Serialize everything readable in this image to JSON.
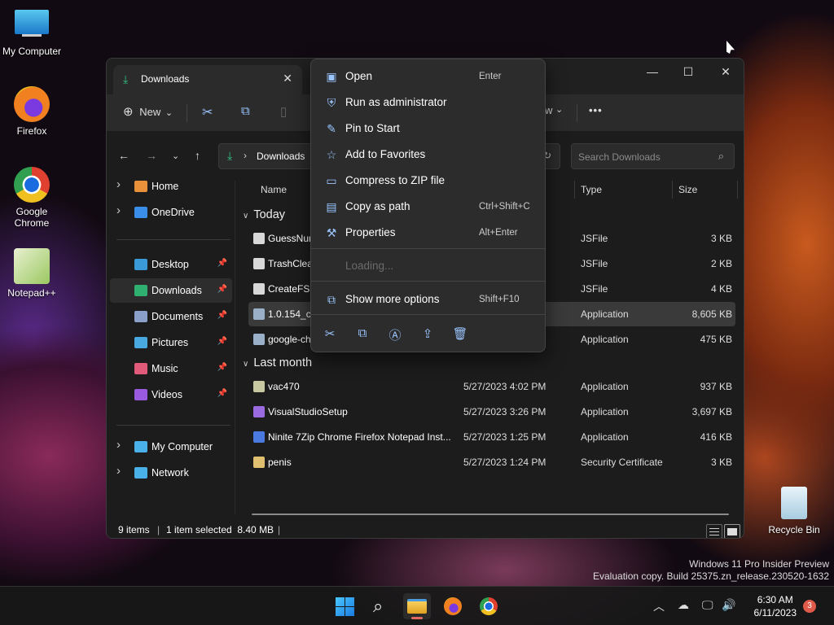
{
  "desktop": {
    "icons": [
      {
        "label": "My Computer",
        "icon": "monitor-icon"
      },
      {
        "label": "Firefox",
        "icon": "firefox-icon"
      },
      {
        "label": "Google Chrome",
        "icon": "chrome-icon"
      },
      {
        "label": "Notepad++",
        "icon": "notepadpp-icon"
      },
      {
        "label": "Recycle Bin",
        "icon": "recycle-bin-icon"
      }
    ],
    "watermark": {
      "line1": "Windows 11 Pro Insider Preview",
      "line2": "Evaluation copy. Build 25375.zn_release.230520-1632"
    }
  },
  "explorer": {
    "tab_title": "Downloads",
    "tab_close": "✕",
    "window_controls": {
      "minimize": "—",
      "maximize": "☐",
      "close": "✕"
    },
    "command_bar": {
      "new_label": "New",
      "new_arrow": "⌄",
      "view_partial": "w",
      "view_arrow": "⌄",
      "more": "•••"
    },
    "address": {
      "separator": "›",
      "location": "Downloads"
    },
    "search": {
      "placeholder": "Search Downloads"
    },
    "columns": {
      "name": "Name",
      "type": "Type",
      "size": "Size"
    },
    "sidebar": {
      "items": [
        {
          "label": "Home",
          "has_chevron": true,
          "pinned": false,
          "selected": false,
          "color": "#e8903a"
        },
        {
          "label": "OneDrive",
          "has_chevron": true,
          "pinned": false,
          "selected": false,
          "color": "#3a8ee8"
        },
        {
          "label": "Desktop",
          "has_chevron": false,
          "pinned": true,
          "selected": false,
          "color": "#3a9ad8"
        },
        {
          "label": "Downloads",
          "has_chevron": false,
          "pinned": true,
          "selected": true,
          "color": "#30b070"
        },
        {
          "label": "Documents",
          "has_chevron": false,
          "pinned": true,
          "selected": false,
          "color": "#8aa0c8"
        },
        {
          "label": "Pictures",
          "has_chevron": false,
          "pinned": true,
          "selected": false,
          "color": "#4aa8e0"
        },
        {
          "label": "Music",
          "has_chevron": false,
          "pinned": true,
          "selected": false,
          "color": "#e05a7a"
        },
        {
          "label": "Videos",
          "has_chevron": false,
          "pinned": true,
          "selected": false,
          "color": "#9a5ae0"
        },
        {
          "label": "My Computer",
          "has_chevron": true,
          "pinned": false,
          "selected": false,
          "color": "#4ab0e8"
        },
        {
          "label": "Network",
          "has_chevron": true,
          "pinned": false,
          "selected": false,
          "color": "#4ab0e8"
        }
      ]
    },
    "groups": {
      "today": "Today",
      "last_month": "Last month"
    },
    "files_today": [
      {
        "name": "GuessNur",
        "date": "",
        "type": "JSFile",
        "size": "3 KB",
        "selected": false,
        "color": "#d8d8d8"
      },
      {
        "name": "TrashClear",
        "date": "",
        "type": "JSFile",
        "size": "2 KB",
        "selected": false,
        "color": "#d8d8d8"
      },
      {
        "name": "CreateFS.j",
        "date": "",
        "type": "JSFile",
        "size": "4 KB",
        "selected": false,
        "color": "#d8d8d8"
      },
      {
        "name": "1.0.154_ch",
        "date": "",
        "type": "Application",
        "size": "8,605 KB",
        "selected": true,
        "color": "#9ab0c8"
      },
      {
        "name": "google-ch",
        "date": "",
        "type": "Application",
        "size": "475 KB",
        "selected": false,
        "color": "#9ab0c8"
      }
    ],
    "files_last_month": [
      {
        "name": "vac470",
        "date": "5/27/2023 4:02 PM",
        "type": "Application",
        "size": "937 KB",
        "selected": false,
        "color": "#c8c8a0"
      },
      {
        "name": "VisualStudioSetup",
        "date": "5/27/2023 3:26 PM",
        "type": "Application",
        "size": "3,697 KB",
        "selected": false,
        "color": "#9a6ae0"
      },
      {
        "name": "Ninite 7Zip Chrome Firefox Notepad Inst...",
        "date": "5/27/2023 1:25 PM",
        "type": "Application",
        "size": "416 KB",
        "selected": false,
        "color": "#4a7ae0"
      },
      {
        "name": "penis",
        "date": "5/27/2023 1:24 PM",
        "type": "Security Certificate",
        "size": "3 KB",
        "selected": false,
        "color": "#e0c070"
      }
    ],
    "status": {
      "items": "9 items",
      "divider": "|",
      "selected": "1 item selected  8.40 MB",
      "divider2": "|"
    }
  },
  "context_menu": {
    "items": [
      {
        "label": "Open",
        "shortcut": "Enter",
        "icon": "open-icon",
        "glyph": "▣",
        "disabled": false
      },
      {
        "label": "Run as administrator",
        "shortcut": "",
        "icon": "shield-icon",
        "glyph": "⛨",
        "disabled": false
      },
      {
        "label": "Pin to Start",
        "shortcut": "",
        "icon": "pin-icon",
        "glyph": "✎",
        "disabled": false
      },
      {
        "label": "Add to Favorites",
        "shortcut": "",
        "icon": "star-icon",
        "glyph": "☆",
        "disabled": false
      },
      {
        "label": "Compress to ZIP file",
        "shortcut": "",
        "icon": "zip-icon",
        "glyph": "▭",
        "disabled": false
      },
      {
        "label": "Copy as path",
        "shortcut": "Ctrl+Shift+C",
        "icon": "copy-path-icon",
        "glyph": "▤",
        "disabled": false
      },
      {
        "label": "Properties",
        "shortcut": "Alt+Enter",
        "icon": "wrench-icon",
        "glyph": "⚒",
        "disabled": false
      },
      {
        "label": "Loading...",
        "shortcut": "",
        "icon": "",
        "glyph": "",
        "disabled": true
      },
      {
        "label": "Show more options",
        "shortcut": "Shift+F10",
        "icon": "more-options-icon",
        "glyph": "⧉",
        "disabled": false
      }
    ],
    "actions": [
      {
        "icon": "cut-icon",
        "glyph": "✂"
      },
      {
        "icon": "copy-icon",
        "glyph": "⧉"
      },
      {
        "icon": "rename-icon",
        "glyph": "Ⓐ"
      },
      {
        "icon": "share-icon",
        "glyph": "⇪"
      },
      {
        "icon": "delete-icon",
        "glyph": "🗑"
      }
    ]
  },
  "taskbar": {
    "clock_time": "6:30 AM",
    "clock_date": "6/11/2023",
    "notification_count": "3",
    "tray": {
      "chevron": "︿",
      "cloud": "☁",
      "display": "🖵",
      "volume": "🔊"
    }
  }
}
